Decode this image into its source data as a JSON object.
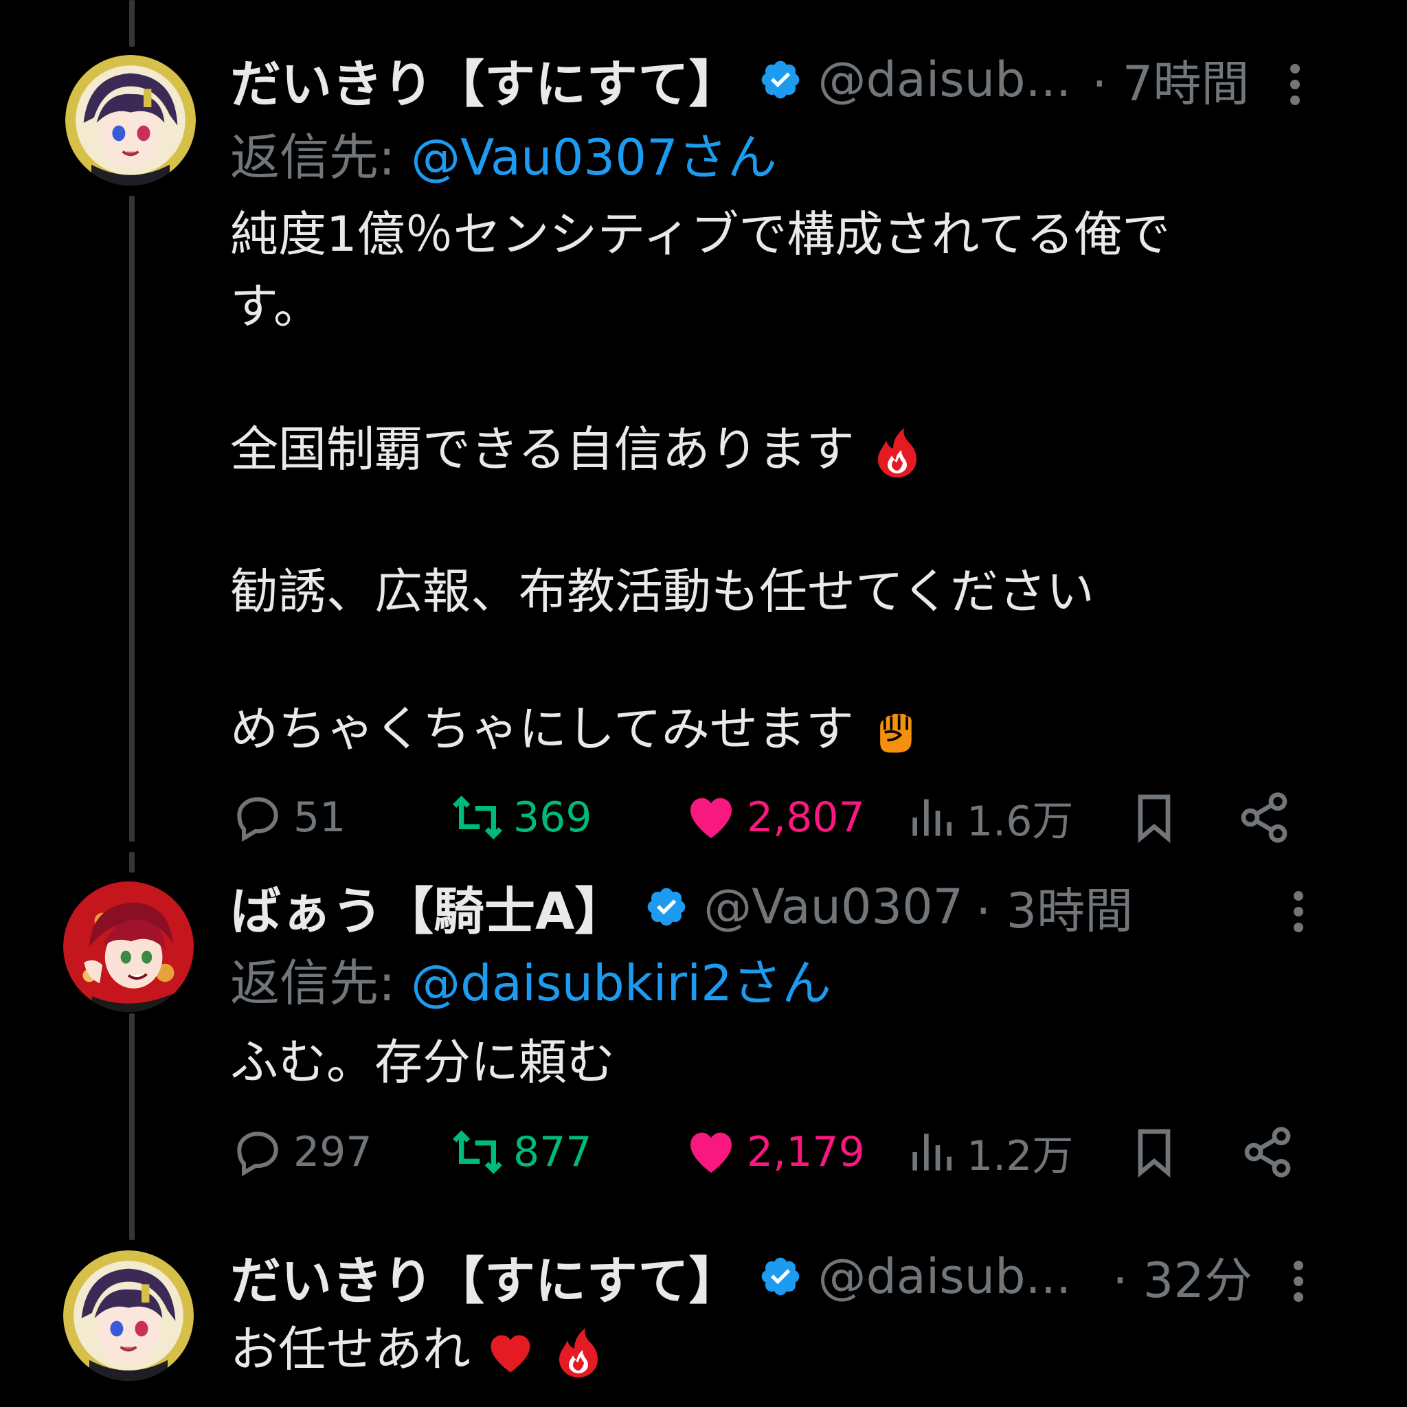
{
  "tweets": [
    {
      "name": "だいきり【すにすて】",
      "handle": "@daisub...",
      "time": "· 7時間",
      "reply_prefix": "返信先: ",
      "reply_to": "@Vau0307さん",
      "lines": [
        "純度1億％センシティブで構成されてる俺で",
        "す。",
        "全国制覇できる自信あります",
        "勧誘、広報、布教活動も任せてください",
        "めちゃくちゃにしてみせます"
      ],
      "replies": "51",
      "retweets": "369",
      "likes": "2,807",
      "views": "1.6万"
    },
    {
      "name": "ばぁう【騎士A】",
      "handle": "@Vau0307",
      "time": "· 3時間",
      "reply_prefix": "返信先: ",
      "reply_to": "@daisubkiri2さん",
      "lines": [
        "ふむ。存分に頼む"
      ],
      "replies": "297",
      "retweets": "877",
      "likes": "2,179",
      "views": "1.2万"
    },
    {
      "name": "だいきり【すにすて】",
      "handle": "@daisub...",
      "time": "· 32分",
      "lines": [
        "お任せあれ"
      ]
    }
  ],
  "icons": {
    "verified": "verified-badge-icon",
    "fire": "fire-emoji",
    "fist": "raised-fist-emoji",
    "heart": "red-heart-emoji"
  },
  "colors": {
    "background": "#000000",
    "text": "#e7e9ea",
    "muted": "#71767b",
    "mention": "#1d9bf0",
    "retweet": "#00ba7c",
    "like": "#f91880"
  }
}
